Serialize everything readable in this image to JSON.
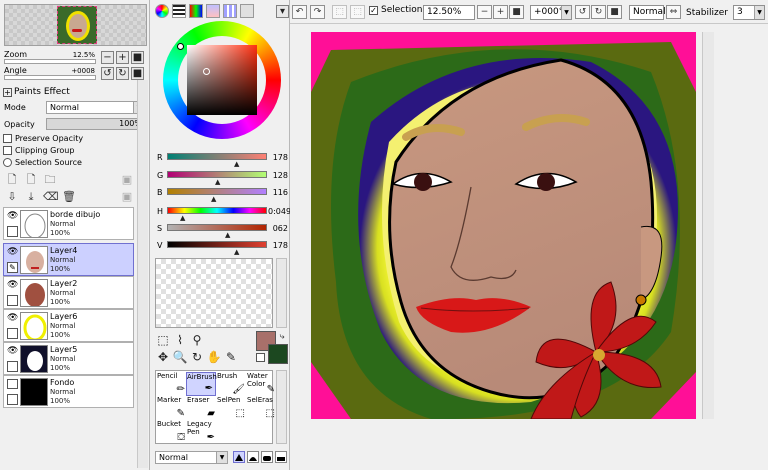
{
  "navigator": {
    "zoom_label": "Zoom",
    "zoom_value": "12.5%",
    "angle_label": "Angle",
    "angle_value": "+0008"
  },
  "paint_effect": {
    "title": "Paints Effect",
    "mode_label": "Mode",
    "mode_value": "Normal",
    "opacity_label": "Opacity",
    "opacity_value": "100%",
    "checkboxes": [
      "Preserve Opacity",
      "Clipping Group"
    ],
    "radio": "Selection Source"
  },
  "layers": [
    {
      "name": "borde dibujo",
      "mode": "Normal",
      "opacity": "100%",
      "selected": false
    },
    {
      "name": "Layer4",
      "mode": "Normal",
      "opacity": "100%",
      "selected": true
    },
    {
      "name": "Layer2",
      "mode": "Normal",
      "opacity": "100%",
      "selected": false
    },
    {
      "name": "Layer6",
      "mode": "Normal",
      "opacity": "100%",
      "selected": false
    },
    {
      "name": "Layer5",
      "mode": "Normal",
      "opacity": "100%",
      "selected": false
    },
    {
      "name": "Fondo",
      "mode": "Normal",
      "opacity": "100%",
      "selected": false
    }
  ],
  "color_sliders": [
    {
      "label": "R",
      "value": "178"
    },
    {
      "label": "G",
      "value": "128"
    },
    {
      "label": "B",
      "value": "116"
    },
    {
      "label": "H",
      "value": "0:049"
    },
    {
      "label": "S",
      "value": "062"
    },
    {
      "label": "V",
      "value": "178"
    }
  ],
  "colors": {
    "foreground": "#a8706a",
    "background": "#1c4820",
    "selection_layer": "#ccd0ff"
  },
  "brushes": [
    {
      "name": "Pencil",
      "icon": "pencil-icon"
    },
    {
      "name": "AirBrush",
      "icon": "airbrush-icon"
    },
    {
      "name": "Brush",
      "icon": "brush-icon"
    },
    {
      "name": "Water\nColor",
      "icon": "watercolor-icon"
    },
    {
      "name": "Marker",
      "icon": "marker-icon"
    },
    {
      "name": "Eraser",
      "icon": "eraser-icon"
    },
    {
      "name": "SelPen",
      "icon": "selpen-icon"
    },
    {
      "name": "SelEras",
      "icon": "seleras-icon"
    },
    {
      "name": "Bucket",
      "icon": "bucket-icon"
    },
    {
      "name": "Legacy\nPen",
      "icon": "legacy-pen-icon"
    }
  ],
  "blend_mode": "Normal",
  "toolbar": {
    "selection_label": "Selection",
    "zoom_value": "12.50%",
    "angle_value": "+000°",
    "mode_value": "Normal",
    "stabilizer_label": "Stabilizer",
    "stabilizer_value": "3"
  }
}
